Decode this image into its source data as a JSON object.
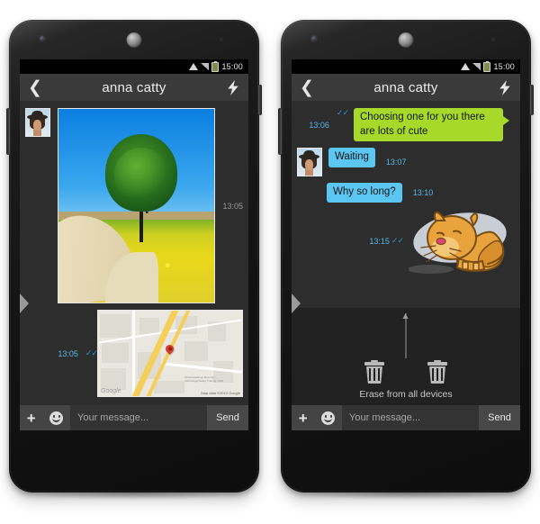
{
  "statusbar": {
    "time": "15:00",
    "wifi_icon": "wifi-icon",
    "signal_icon": "signal-icon",
    "battery_icon": "battery-icon"
  },
  "header": {
    "back_icon": "back-chevron-icon",
    "title": "anna catty",
    "action_icon": "lightning-bolt-icon"
  },
  "composer": {
    "attach_label": "+",
    "emoji_icon": "smiley-icon",
    "placeholder": "Your message...",
    "send_label": "Send"
  },
  "colors": {
    "bubble_outgoing": "#a6d92a",
    "bubble_incoming": "#5cc6f2",
    "timestamp_blue": "#59b7e8",
    "tick_blue": "#2f8ed6",
    "appbar": "#3a3a3a",
    "chat_bg": "#2d2d2d"
  },
  "phone_left": {
    "messages": [
      {
        "type": "photo",
        "alt": "tree in yellow rapeseed field with dirt road",
        "time": "13:05",
        "ticks": "",
        "has_avatar": true
      },
      {
        "type": "map",
        "alt": "google map with red location pin",
        "time": "13:05",
        "ticks": "✓✓",
        "has_avatar": false
      }
    ],
    "map": {
      "attribution": "Map data ©2013 Google",
      "watermark": "Google",
      "place_label": "Obrazovatelnye\nResursy i\nTekhnologicheskiy\nTrening, ANO"
    },
    "drawer_handle_icon": "drawer-handle-icon"
  },
  "phone_right": {
    "messages": [
      {
        "type": "text",
        "side": "outgoing",
        "text": "Choosing one for you there are lots of cute",
        "time": "13:06",
        "ticks": "✓✓"
      },
      {
        "type": "text",
        "side": "incoming",
        "text": "Waiting",
        "time": "13:07",
        "ticks": "",
        "has_avatar": true
      },
      {
        "type": "text",
        "side": "incoming",
        "text": "Why so long?",
        "time": "13:10",
        "ticks": ""
      },
      {
        "type": "sticker",
        "side": "outgoing",
        "alt": "orange cat sticker resting on pillow",
        "time": "13:15",
        "ticks": "✓✓"
      }
    ],
    "erase_panel": {
      "label": "Erase from all devices",
      "bin_icon": "trash-can-icon",
      "arrow_icon": "up-arrow-icon"
    },
    "drawer_handle_icon": "drawer-handle-icon"
  }
}
